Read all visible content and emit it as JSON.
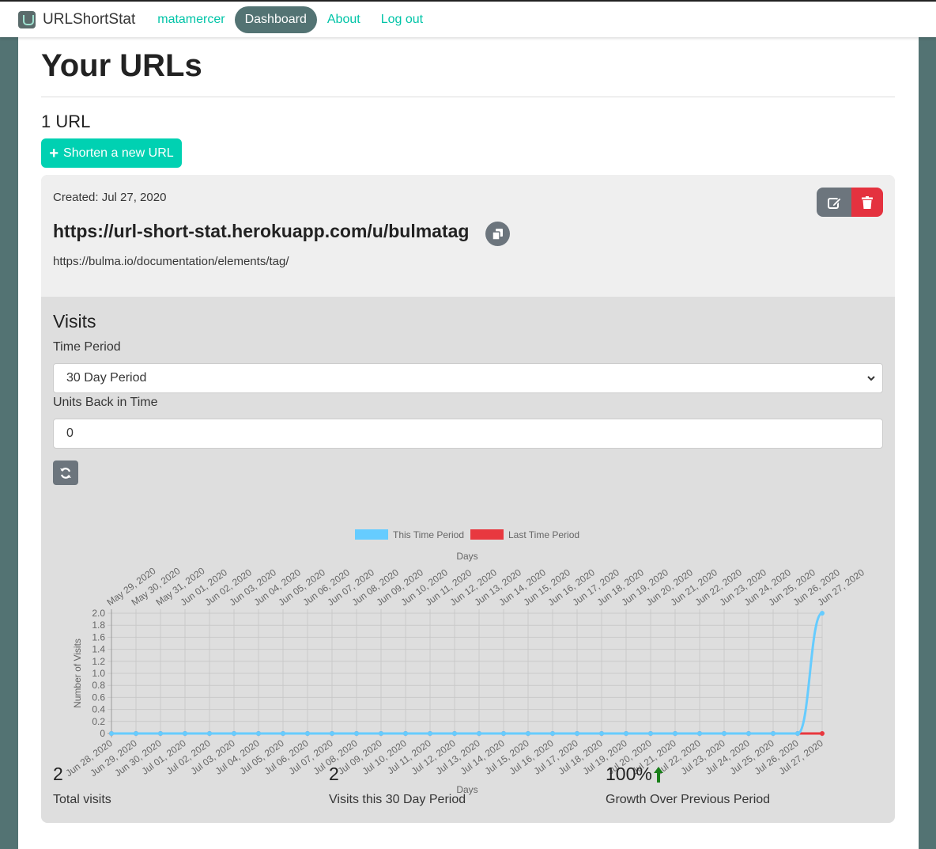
{
  "nav": {
    "brand": "URLShortStat",
    "links": [
      {
        "label": "matamercer"
      },
      {
        "label": "Dashboard"
      },
      {
        "label": "About"
      },
      {
        "label": "Log out"
      }
    ]
  },
  "page": {
    "title": "Your URLs",
    "count": "1 URL",
    "new_button": "Shorten a new URL"
  },
  "url_card": {
    "created": "Created: Jul 27, 2020",
    "short_url": "https://url-short-stat.herokuapp.com/u/bulmatag",
    "long_url": "https://bulma.io/documentation/elements/tag/"
  },
  "visits": {
    "title": "Visits",
    "period_label": "Time Period",
    "period_value": "30 Day Period",
    "units_label": "Units Back in Time",
    "units_value": "0"
  },
  "stats": [
    {
      "value": "2",
      "label": "Total visits"
    },
    {
      "value": "2",
      "label": "Visits this 30 Day Period"
    },
    {
      "value": "100%",
      "label": "Growth Over Previous Period"
    }
  ],
  "colors": {
    "accent": "#00d1b2",
    "nav_active": "#537373",
    "this_period": "#66ccff",
    "last_period": "#e8383f",
    "growth_arrow": "#1a7f1a"
  },
  "chart_data": {
    "type": "line",
    "legend": [
      "This Time Period",
      "Last Time Period"
    ],
    "legend_position": "top",
    "xlabel_top": "Days",
    "xlabel_bottom": "Days",
    "ylabel": "Number of Visits",
    "ylim": [
      0,
      2
    ],
    "yticks": [
      "0",
      "0.2",
      "0.4",
      "0.6",
      "0.8",
      "1.0",
      "1.2",
      "1.4",
      "1.6",
      "1.8",
      "2.0"
    ],
    "x_top": [
      "May 29, 2020",
      "May 30, 2020",
      "May 31, 2020",
      "Jun 01, 2020",
      "Jun 02, 2020",
      "Jun 03, 2020",
      "Jun 04, 2020",
      "Jun 05, 2020",
      "Jun 06, 2020",
      "Jun 07, 2020",
      "Jun 08, 2020",
      "Jun 09, 2020",
      "Jun 10, 2020",
      "Jun 11, 2020",
      "Jun 12, 2020",
      "Jun 13, 2020",
      "Jun 14, 2020",
      "Jun 15, 2020",
      "Jun 16, 2020",
      "Jun 17, 2020",
      "Jun 18, 2020",
      "Jun 19, 2020",
      "Jun 20, 2020",
      "Jun 21, 2020",
      "Jun 22, 2020",
      "Jun 23, 2020",
      "Jun 24, 2020",
      "Jun 25, 2020",
      "Jun 26, 2020",
      "Jun 27, 2020"
    ],
    "x_bottom": [
      "Jun 28, 2020",
      "Jun 29, 2020",
      "Jun 30, 2020",
      "Jul 01, 2020",
      "Jul 02, 2020",
      "Jul 03, 2020",
      "Jul 04, 2020",
      "Jul 05, 2020",
      "Jul 06, 2020",
      "Jul 07, 2020",
      "Jul 08, 2020",
      "Jul 09, 2020",
      "Jul 10, 2020",
      "Jul 11, 2020",
      "Jul 12, 2020",
      "Jul 13, 2020",
      "Jul 14, 2020",
      "Jul 15, 2020",
      "Jul 16, 2020",
      "Jul 17, 2020",
      "Jul 18, 2020",
      "Jul 19, 2020",
      "Jul 20, 2020",
      "Jul 21, 2020",
      "Jul 22, 2020",
      "Jul 23, 2020",
      "Jul 24, 2020",
      "Jul 25, 2020",
      "Jul 26, 2020",
      "Jul 27, 2020"
    ],
    "series": [
      {
        "name": "This Time Period",
        "values": [
          0,
          0,
          0,
          0,
          0,
          0,
          0,
          0,
          0,
          0,
          0,
          0,
          0,
          0,
          0,
          0,
          0,
          0,
          0,
          0,
          0,
          0,
          0,
          0,
          0,
          0,
          0,
          0,
          0,
          2
        ]
      },
      {
        "name": "Last Time Period",
        "values": [
          0,
          0,
          0,
          0,
          0,
          0,
          0,
          0,
          0,
          0,
          0,
          0,
          0,
          0,
          0,
          0,
          0,
          0,
          0,
          0,
          0,
          0,
          0,
          0,
          0,
          0,
          0,
          0,
          0,
          0
        ]
      }
    ],
    "grid": true
  }
}
